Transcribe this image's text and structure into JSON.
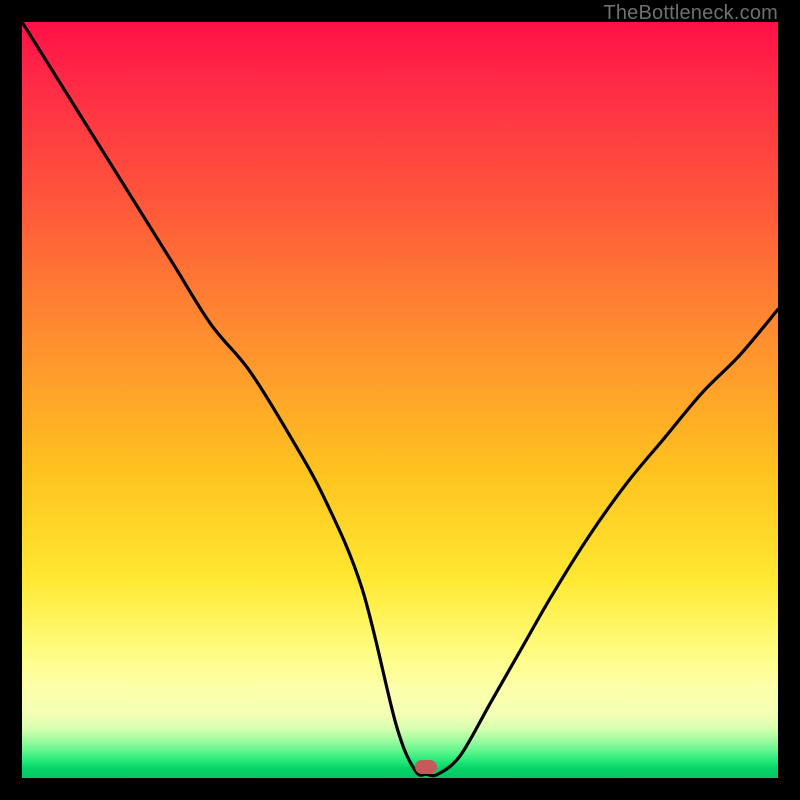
{
  "attribution": "TheBottleneck.com",
  "colors": {
    "frame": "#000000",
    "gradient_top": "#ff1048",
    "gradient_mid": "#ffe933",
    "gradient_bottom": "#05c763",
    "curve": "#000000",
    "marker": "#c55a5a",
    "attribution_text": "#6f6f6f"
  },
  "marker": {
    "x_frac": 0.535,
    "y_frac": 0.985
  },
  "chart_data": {
    "type": "line",
    "title": "",
    "xlabel": "",
    "ylabel": "",
    "xlim": [
      0,
      1
    ],
    "ylim": [
      0,
      1
    ],
    "note": "Axes are normalized (no tick labels visible). y represents bottleneck severity: 0 = balanced (green strip at bottom), 1 = severe (red at top). Curve dips to ~0 near x≈0.53 where the marker sits.",
    "series": [
      {
        "name": "bottleneck-curve",
        "x": [
          0.0,
          0.05,
          0.1,
          0.15,
          0.2,
          0.25,
          0.3,
          0.35,
          0.4,
          0.45,
          0.495,
          0.52,
          0.535,
          0.55,
          0.58,
          0.62,
          0.66,
          0.7,
          0.75,
          0.8,
          0.85,
          0.9,
          0.95,
          1.0
        ],
        "y": [
          1.0,
          0.92,
          0.84,
          0.76,
          0.68,
          0.6,
          0.54,
          0.46,
          0.37,
          0.25,
          0.07,
          0.01,
          0.005,
          0.005,
          0.03,
          0.1,
          0.17,
          0.24,
          0.32,
          0.39,
          0.45,
          0.51,
          0.56,
          0.62
        ]
      }
    ],
    "marker_point": {
      "x": 0.535,
      "y": 0.005
    }
  }
}
